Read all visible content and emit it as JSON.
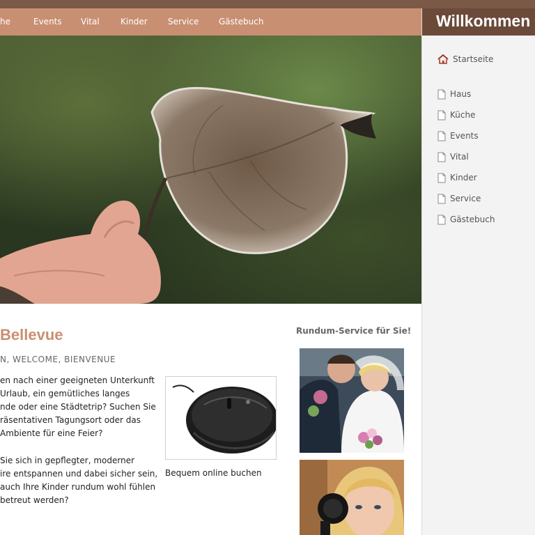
{
  "nav": {
    "items": [
      "he",
      "Events",
      "Vital",
      "Kinder",
      "Service",
      "Gästebuch"
    ]
  },
  "sidebar": {
    "header": "Willkommen",
    "home": "Startseite",
    "items": [
      "Haus",
      "Küche",
      "Events",
      "Vital",
      "Kinder",
      "Service",
      "Gästebuch"
    ]
  },
  "content": {
    "title": "Bellevue",
    "subtitle": "N, WELCOME, BIENVENUE",
    "paragraph1": [
      "en nach einer geeigneten Unterkunft",
      "Urlaub, ein gemütliches langes",
      "nde oder eine Städtetrip? Suchen Sie",
      "räsentativen Tagungsort oder das",
      "Ambiente für eine Feier?"
    ],
    "paragraph2": [
      "Sie sich in gepflegter, moderner",
      "ire entspannen und dabei sicher sein,",
      "auch Ihre Kinder rundum wohl fühlen",
      "betreut werden?"
    ],
    "mouse_caption": "Bequem online buchen"
  },
  "service": {
    "title": "Rundum-Service für Sie!"
  },
  "colors": {
    "nav": "#c98f72",
    "sidebar_header": "#6b4a39",
    "accent": "#c98f72"
  }
}
